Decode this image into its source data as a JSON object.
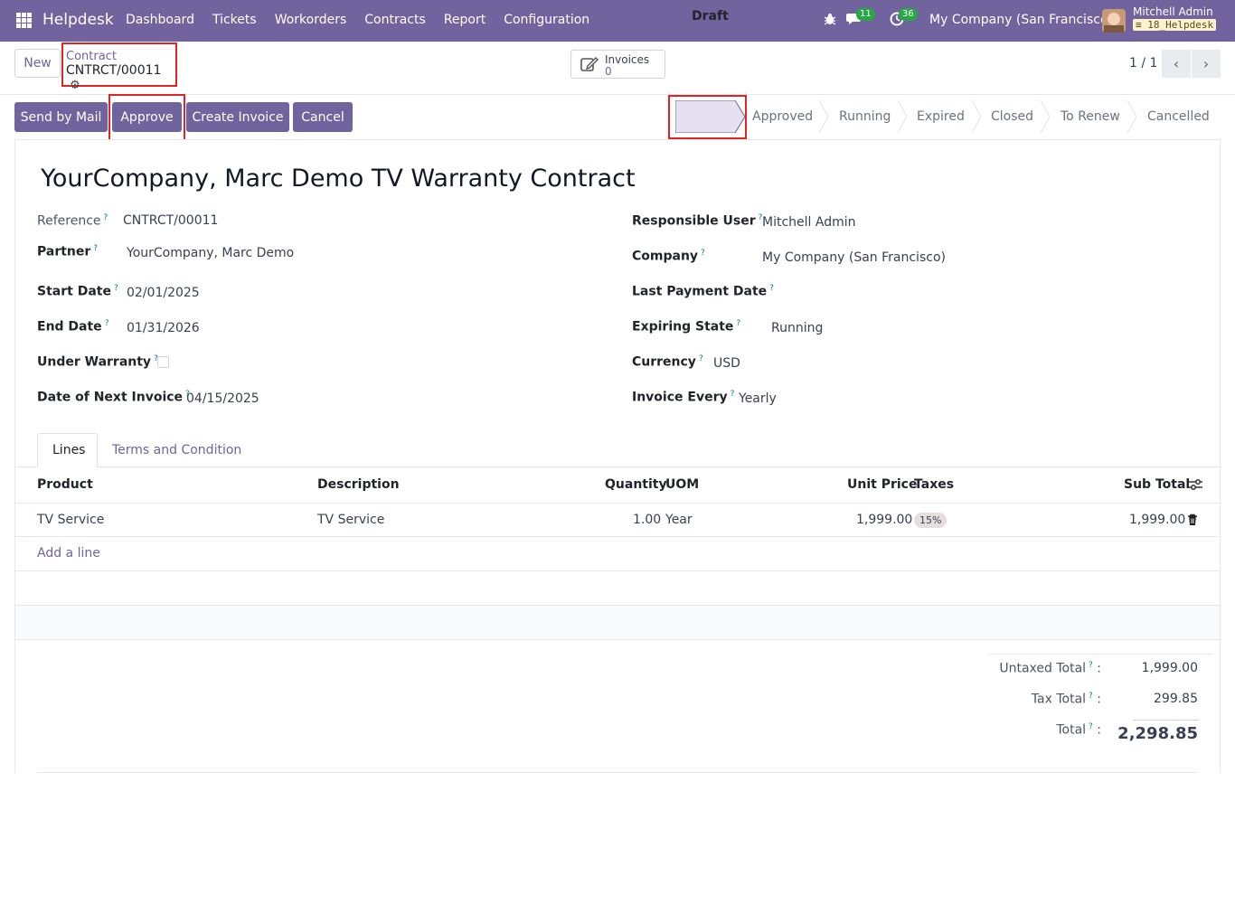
{
  "topbar": {
    "app_name": "Helpdesk",
    "menu": [
      "Dashboard",
      "Tickets",
      "Workorders",
      "Contracts",
      "Report",
      "Configuration"
    ],
    "messages_count": "11",
    "activities_count": "36",
    "company": "My Company (San Francisco)",
    "user_name": "Mitchell Admin",
    "database": "18_Helpdesk"
  },
  "control_panel": {
    "new_label": "New",
    "breadcrumb_parent": "Contract",
    "breadcrumb_current": "CNTRCT/00011",
    "smart_button_label": "Invoices",
    "smart_button_count": "0",
    "pager": "1 / 1"
  },
  "actions": {
    "send_by_mail": "Send by Mail",
    "approve": "Approve",
    "create_invoice": "Create Invoice",
    "cancel": "Cancel"
  },
  "statusbar": {
    "stages": [
      "Draft",
      "Approved",
      "Running",
      "Expired",
      "Closed",
      "To Renew",
      "Cancelled"
    ],
    "active": "Draft"
  },
  "form": {
    "title": "YourCompany, Marc Demo TV Warranty Contract",
    "reference_label": "Reference",
    "reference": "CNTRCT/00011",
    "partner_label": "Partner",
    "partner": "YourCompany, Marc Demo",
    "start_date_label": "Start Date",
    "start_date": "02/01/2025",
    "end_date_label": "End Date",
    "end_date": "01/31/2026",
    "under_warranty_label": "Under Warranty",
    "under_warranty": false,
    "next_invoice_label": "Date of Next Invoice",
    "next_invoice": "04/15/2025",
    "responsible_label": "Responsible User",
    "responsible": "Mitchell Admin",
    "company_label": "Company",
    "company": "My Company (San Francisco)",
    "last_payment_label": "Last Payment Date",
    "last_payment": "",
    "expiring_state_label": "Expiring State",
    "expiring_state": "Running",
    "currency_label": "Currency",
    "currency": "USD",
    "invoice_every_label": "Invoice Every",
    "invoice_every": "Yearly",
    "help_mark": "?"
  },
  "tabs": [
    "Lines",
    "Terms and Condition"
  ],
  "lines_table": {
    "headers": [
      "Product",
      "Description",
      "Quantity",
      "UOM",
      "Unit Price",
      "Taxes",
      "Sub Total"
    ],
    "rows": [
      {
        "product": "TV Service",
        "description": "TV Service",
        "quantity": "1.00",
        "uom": "Year",
        "unit_price": "1,999.00",
        "taxes": "15%",
        "subtotal": "1,999.00"
      }
    ],
    "add_line": "Add a line"
  },
  "totals": {
    "untaxed_label": "Untaxed Total",
    "untaxed": "1,999.00",
    "tax_label": "Tax Total",
    "tax": "299.85",
    "total_label": "Total",
    "total": "2,298.85",
    "colon": ":"
  },
  "colors": {
    "brand": "#71639e",
    "highlight": "#e02424",
    "badge_green": "#28a745"
  }
}
